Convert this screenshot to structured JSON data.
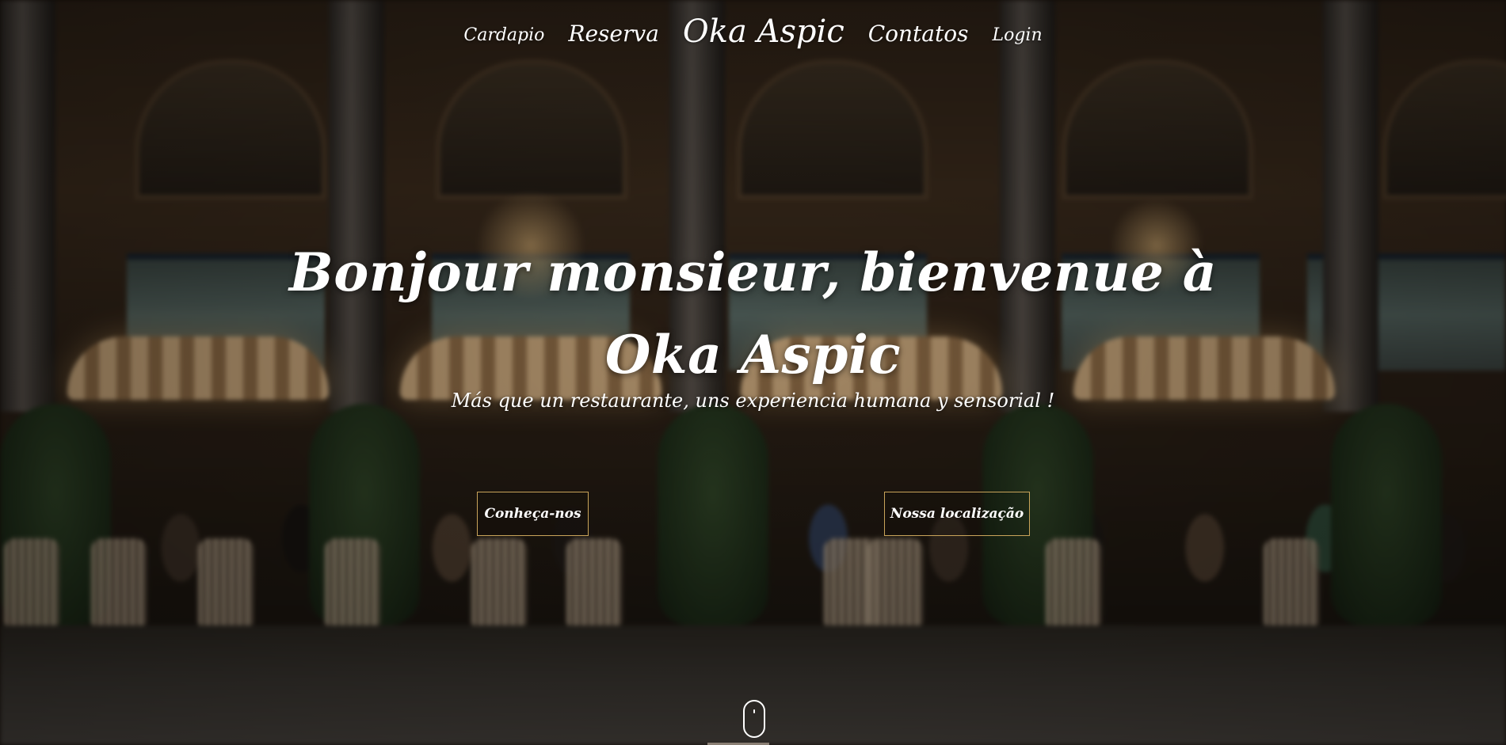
{
  "nav": {
    "items": [
      {
        "label": "Cardapio"
      },
      {
        "label": "Reserva"
      },
      {
        "label": "Oka Aspic"
      },
      {
        "label": "Contatos"
      },
      {
        "label": "Login"
      }
    ]
  },
  "hero": {
    "headline_line1": "Bonjour monsieur, bienvenue à",
    "headline_line2": "Oka Aspic",
    "subtitle": "Más que un restaurante, uns experiencia humana y sensorial !",
    "buttons": {
      "about": "Conheça-nos",
      "location": "Nossa localização"
    }
  },
  "colors": {
    "accent_border": "#c9a45a",
    "text": "#ffffff"
  },
  "icons": {
    "scroll": "mouse-scroll-icon"
  }
}
